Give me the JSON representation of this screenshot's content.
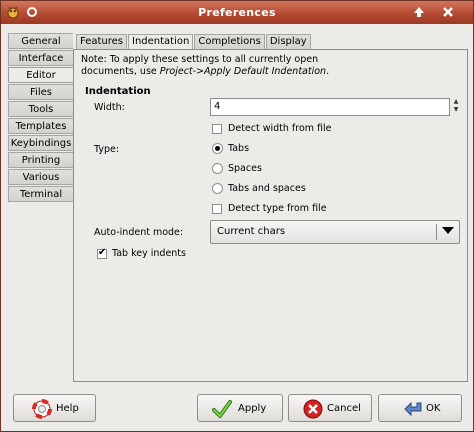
{
  "window": {
    "title": "Preferences"
  },
  "sidebar": {
    "items": [
      {
        "label": "General"
      },
      {
        "label": "Interface"
      },
      {
        "label": "Editor"
      },
      {
        "label": "Files"
      },
      {
        "label": "Tools"
      },
      {
        "label": "Templates"
      },
      {
        "label": "Keybindings"
      },
      {
        "label": "Printing"
      },
      {
        "label": "Various"
      },
      {
        "label": "Terminal"
      }
    ],
    "active": "Editor"
  },
  "tabs": {
    "items": [
      {
        "label": "Features"
      },
      {
        "label": "Indentation"
      },
      {
        "label": "Completions"
      },
      {
        "label": "Display"
      }
    ],
    "active": "Indentation"
  },
  "note": {
    "line1": "Note: To apply these settings to all currently open",
    "line2_prefix": "documents, use ",
    "line2_italic": "Project->Apply Default Indentation",
    "line2_suffix": "."
  },
  "indentation": {
    "heading": "Indentation",
    "width_label": "Width:",
    "width_value": "4",
    "detect_width_label": "Detect width from file",
    "detect_width_checked": false,
    "type_label": "Type:",
    "type_options": [
      "Tabs",
      "Spaces",
      "Tabs and spaces"
    ],
    "type_selected": "Tabs",
    "detect_type_label": "Detect type from file",
    "detect_type_checked": false,
    "auto_indent_label": "Auto-indent mode:",
    "auto_indent_value": "Current chars",
    "tab_key_label": "Tab key indents",
    "tab_key_checked": true
  },
  "buttons": {
    "help": "Help",
    "apply": "Apply",
    "cancel": "Cancel",
    "ok": "OK"
  },
  "icons": {
    "titlebar_app": "geany-icon",
    "titlebar_pin": "pin-icon",
    "titlebar_up": "maximize-arrow-icon",
    "titlebar_close": "close-icon",
    "help": "lifebuoy-icon",
    "apply": "checkmark-icon",
    "cancel": "cancel-icon",
    "ok": "ok-arrow-icon"
  },
  "colors": {
    "titlebar": "#b44a31",
    "window_bg": "#ecebe8"
  }
}
